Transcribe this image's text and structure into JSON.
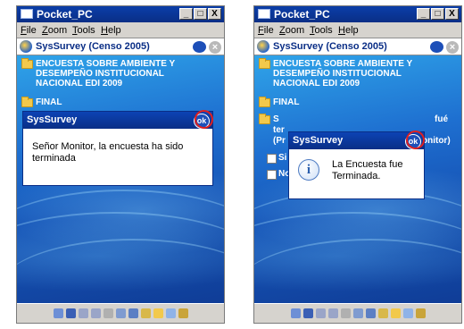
{
  "screens": [
    {
      "window_title": "Pocket_PC",
      "window_buttons": [
        "_",
        "□",
        "X"
      ],
      "menu": [
        "File",
        "Zoom",
        "Tools",
        "Help"
      ],
      "app_title": "SysSurvey  (Censo 2005)",
      "tree": {
        "root_label_lines": [
          "ENCUESTA SOBRE AMBIENTE Y",
          "DESEMPEÑO INSTITUCIONAL",
          "NACIONAL EDI 2009"
        ],
        "final_label": "FINAL"
      },
      "dialog": {
        "title": "SysSurvey",
        "ok_label": "ok",
        "message": "Señor Monitor, la encuesta ha sido terminada"
      }
    },
    {
      "window_title": "Pocket_PC",
      "window_buttons": [
        "_",
        "□",
        "X"
      ],
      "menu": [
        "File",
        "Zoom",
        "Tools",
        "Help"
      ],
      "app_title": "SysSurvey  (Censo 2005)",
      "tree": {
        "root_label_lines": [
          "ENCUESTA SOBRE AMBIENTE Y",
          "DESEMPEÑO INSTITUCIONAL",
          "NACIONAL EDI 2009"
        ],
        "final_label": "FINAL",
        "partial_text": [
          "S",
          "fué",
          "ter",
          "(Pr",
          "onitor)"
        ],
        "options": [
          "Si",
          "No"
        ]
      },
      "dialog": {
        "title": "SysSurvey",
        "ok_label": "ok",
        "message": "La Encuesta fue Terminada.",
        "icon": "info-icon"
      }
    }
  ],
  "colors": {
    "titlebar": "#0a2e86",
    "background_blue": "#1e6fd0",
    "ok_highlight": "#e02020"
  }
}
